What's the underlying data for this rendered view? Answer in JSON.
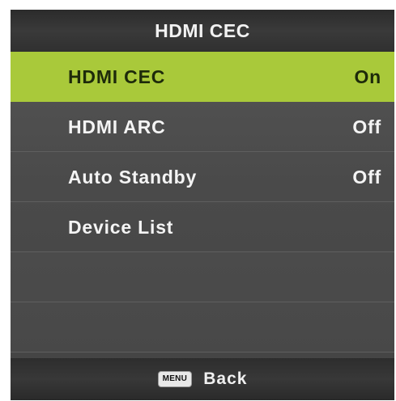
{
  "header": {
    "title": "HDMI CEC"
  },
  "menu": {
    "items": [
      {
        "label": "HDMI CEC",
        "value": "On"
      },
      {
        "label": "HDMI ARC",
        "value": "Off"
      },
      {
        "label": "Auto Standby",
        "value": "Off"
      },
      {
        "label": "Device List",
        "value": ""
      }
    ],
    "selected_index": 0
  },
  "footer": {
    "key_label": "MENU",
    "action_label": "Back"
  },
  "colors": {
    "highlight": "#a9c93a",
    "panel": "#4b4b4b",
    "header": "#333333"
  }
}
